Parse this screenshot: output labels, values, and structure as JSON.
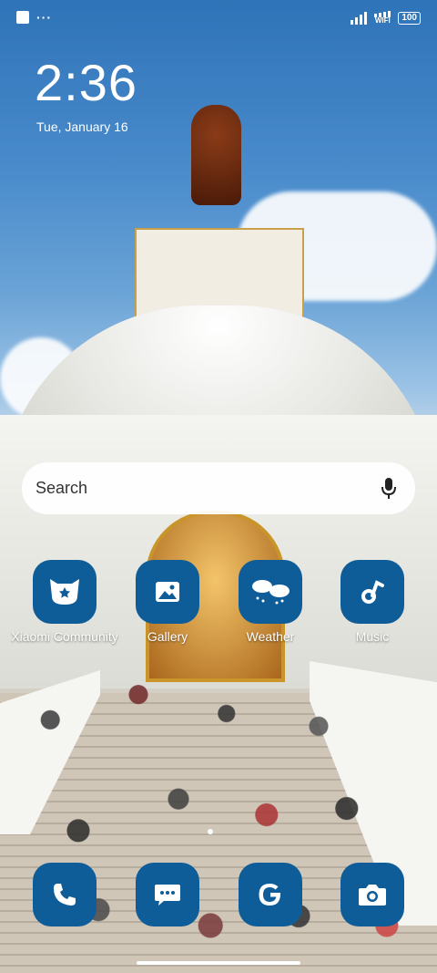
{
  "status": {
    "wifi_label": "WIFI",
    "battery": "100"
  },
  "lock": {
    "time": "2:36",
    "date": "Tue, January 16"
  },
  "search": {
    "placeholder": "Search"
  },
  "apps": [
    {
      "label": "Xiaomi Community",
      "icon": "xiaomi-community-icon"
    },
    {
      "label": "Gallery",
      "icon": "gallery-icon"
    },
    {
      "label": "Weather",
      "icon": "weather-icon"
    },
    {
      "label": "Music",
      "icon": "music-icon"
    }
  ],
  "dock": [
    {
      "icon": "phone-icon"
    },
    {
      "icon": "messages-icon"
    },
    {
      "icon": "google-icon"
    },
    {
      "icon": "camera-icon"
    }
  ],
  "colors": {
    "icon_bg": "#0e5d98",
    "text": "#ffffff"
  }
}
